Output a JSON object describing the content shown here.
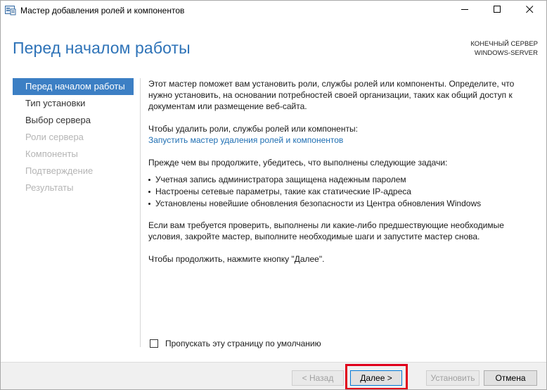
{
  "window": {
    "title": "Мастер добавления ролей и компонентов",
    "icon": "server-manager-icon",
    "controls": {
      "minimize_icon": "minimize-icon",
      "maximize_icon": "maximize-icon",
      "close_icon": "close-icon"
    }
  },
  "header": {
    "title": "Перед началом работы",
    "server_label": "КОНЕЧНЫЙ СЕРВЕР",
    "server_name": "WINDOWS-SERVER"
  },
  "nav": {
    "items": [
      {
        "label": "Перед началом работы",
        "state": "selected"
      },
      {
        "label": "Тип установки",
        "state": "enabled"
      },
      {
        "label": "Выбор сервера",
        "state": "enabled"
      },
      {
        "label": "Роли сервера",
        "state": "disabled"
      },
      {
        "label": "Компоненты",
        "state": "disabled"
      },
      {
        "label": "Подтверждение",
        "state": "disabled"
      },
      {
        "label": "Результаты",
        "state": "disabled"
      }
    ]
  },
  "content": {
    "intro": "Этот мастер поможет вам установить роли, службы ролей или компоненты. Определите, что нужно установить, на основании потребностей своей организации, таких как общий доступ к документам или размещение веб-сайта.",
    "remove_text": "Чтобы удалить роли, службы ролей или компоненты:",
    "remove_link": "Запустить мастер удаления ролей и компонентов",
    "before_text": "Прежде чем вы продолжите, убедитесь, что выполнены следующие задачи:",
    "bullets": [
      "Учетная запись администратора защищена надежным паролем",
      "Настроены сетевые параметры, такие как статические IP-адреса",
      "Установлены новейшие обновления безопасности из Центра обновления Windows"
    ],
    "verify_text": "Если вам требуется проверить, выполнены ли какие-либо предшествующие необходимые условия, закройте мастер, выполните необходимые шаги и запустите мастер снова.",
    "continue_text": "Чтобы продолжить, нажмите кнопку \"Далее\"."
  },
  "skip_checkbox": {
    "label": "Пропускать эту страницу по умолчанию",
    "checked": false
  },
  "footer": {
    "back_label": "< Назад",
    "next_label": "Далее >",
    "install_label": "Установить",
    "cancel_label": "Отмена"
  },
  "colors": {
    "accent": "#2e73b8",
    "selected_nav": "#3c7fc4",
    "link": "#1f6fb3",
    "highlight": "#e0001b"
  }
}
